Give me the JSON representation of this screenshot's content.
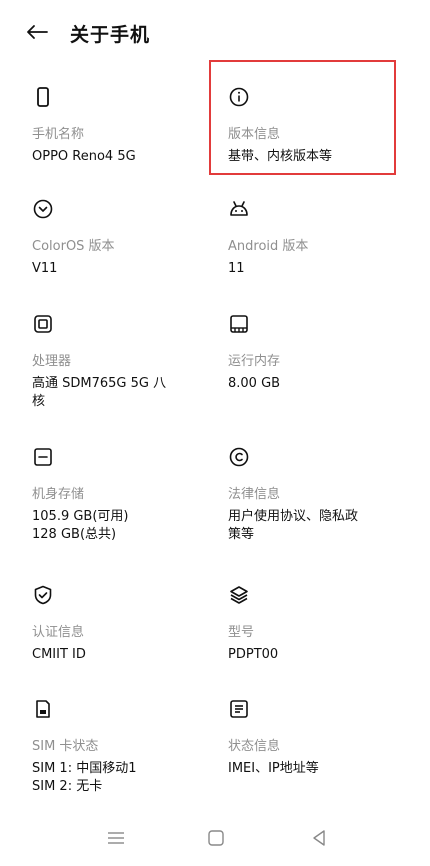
{
  "header": {
    "title": "关于手机"
  },
  "items": [
    {
      "label": "手机名称",
      "value": "OPPO Reno4 5G"
    },
    {
      "label": "版本信息",
      "value": "基带、内核版本等"
    },
    {
      "label": "ColorOS 版本",
      "value": "V11"
    },
    {
      "label": "Android 版本",
      "value": "11"
    },
    {
      "label": "处理器",
      "value": "高通 SDM765G 5G 八\n核"
    },
    {
      "label": "运行内存",
      "value": "8.00 GB"
    },
    {
      "label": "机身存储",
      "value": "105.9 GB(可用)\n128 GB(总共)"
    },
    {
      "label": "法律信息",
      "value": "用户使用协议、隐私政\n策等"
    },
    {
      "label": "认证信息",
      "value": "CMIIT ID"
    },
    {
      "label": "型号",
      "value": "PDPT00"
    },
    {
      "label": "SIM 卡状态",
      "value": "SIM 1: 中国移动1\nSIM 2: 无卡"
    },
    {
      "label": "状态信息",
      "value": "IMEI、IP地址等"
    }
  ]
}
